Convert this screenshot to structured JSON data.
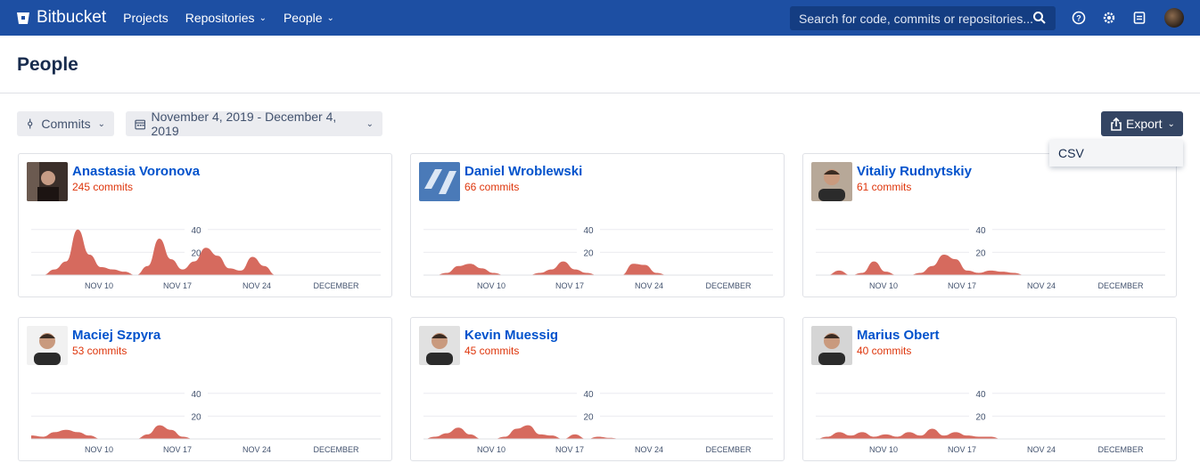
{
  "brand": {
    "name": "Bitbucket"
  },
  "nav": {
    "items": [
      {
        "label": "Projects",
        "dropdown": false
      },
      {
        "label": "Repositories",
        "dropdown": true
      },
      {
        "label": "People",
        "dropdown": true
      }
    ]
  },
  "search": {
    "placeholder": "Search for code, commits or repositories..."
  },
  "top_icons": [
    "help-icon",
    "settings-icon",
    "notes-icon"
  ],
  "page": {
    "title": "People"
  },
  "filters": {
    "metric_label": "Commits",
    "date_range": "November 4, 2019 - December 4, 2019"
  },
  "export": {
    "label": "Export",
    "menu": [
      "CSV"
    ]
  },
  "colors": {
    "nav": "#1d4fa3",
    "link": "#0052cc",
    "accent": "#de350b",
    "area": "#d66a5e"
  },
  "people": [
    {
      "name": "Anastasia Voronova",
      "commits": "245 commits",
      "avatar": "portrait-dark",
      "series": [
        0,
        0,
        5,
        12,
        40,
        18,
        7,
        5,
        3,
        0,
        8,
        32,
        14,
        5,
        12,
        24,
        17,
        6,
        4,
        16,
        8,
        0,
        0,
        0,
        0,
        0,
        0,
        0,
        0,
        0,
        0
      ]
    },
    {
      "name": "Daniel Wroblewski",
      "commits": "66 commits",
      "avatar": "logo-blue",
      "series": [
        0,
        0,
        2,
        8,
        10,
        6,
        2,
        0,
        0,
        0,
        2,
        5,
        12,
        5,
        2,
        0,
        0,
        0,
        10,
        9,
        2,
        0,
        0,
        0,
        0,
        0,
        0,
        0,
        0,
        0,
        0
      ]
    },
    {
      "name": "Vitaliy Rudnytskiy",
      "commits": "61 commits",
      "avatar": "portrait",
      "series": [
        0,
        0,
        4,
        0,
        2,
        12,
        3,
        0,
        0,
        2,
        8,
        18,
        14,
        4,
        2,
        4,
        3,
        2,
        0,
        0,
        0,
        0,
        0,
        0,
        0,
        0,
        0,
        0,
        0,
        0,
        0
      ]
    },
    {
      "name": "Maciej Szpyra",
      "commits": "53 commits",
      "avatar": "portrait",
      "series": [
        3,
        2,
        6,
        8,
        6,
        3,
        0,
        0,
        0,
        0,
        4,
        12,
        8,
        2,
        0,
        0,
        0,
        0,
        0,
        0,
        0,
        0,
        0,
        0,
        0,
        0,
        0,
        0,
        0,
        0,
        0
      ]
    },
    {
      "name": "Kevin Muessig",
      "commits": "45 commits",
      "avatar": "portrait",
      "series": [
        0,
        2,
        5,
        10,
        4,
        0,
        0,
        2,
        9,
        12,
        4,
        3,
        0,
        4,
        0,
        2,
        1,
        0,
        0,
        0,
        0,
        0,
        0,
        0,
        0,
        0,
        0,
        0,
        0,
        0,
        0
      ]
    },
    {
      "name": "Marius Obert",
      "commits": "40 commits",
      "avatar": "portrait",
      "series": [
        0,
        2,
        6,
        3,
        6,
        2,
        4,
        2,
        6,
        3,
        9,
        3,
        6,
        3,
        2,
        2,
        0,
        0,
        0,
        0,
        0,
        0,
        0,
        0,
        0,
        0,
        0,
        0,
        0,
        0,
        0
      ]
    }
  ],
  "chart_data": {
    "type": "area",
    "x_ticks": [
      "NOV 10",
      "NOV 17",
      "NOV 24",
      "DECEMBER"
    ],
    "y_ticks": [
      "40",
      "20"
    ],
    "ylim": [
      0,
      50
    ],
    "grid": true
  }
}
